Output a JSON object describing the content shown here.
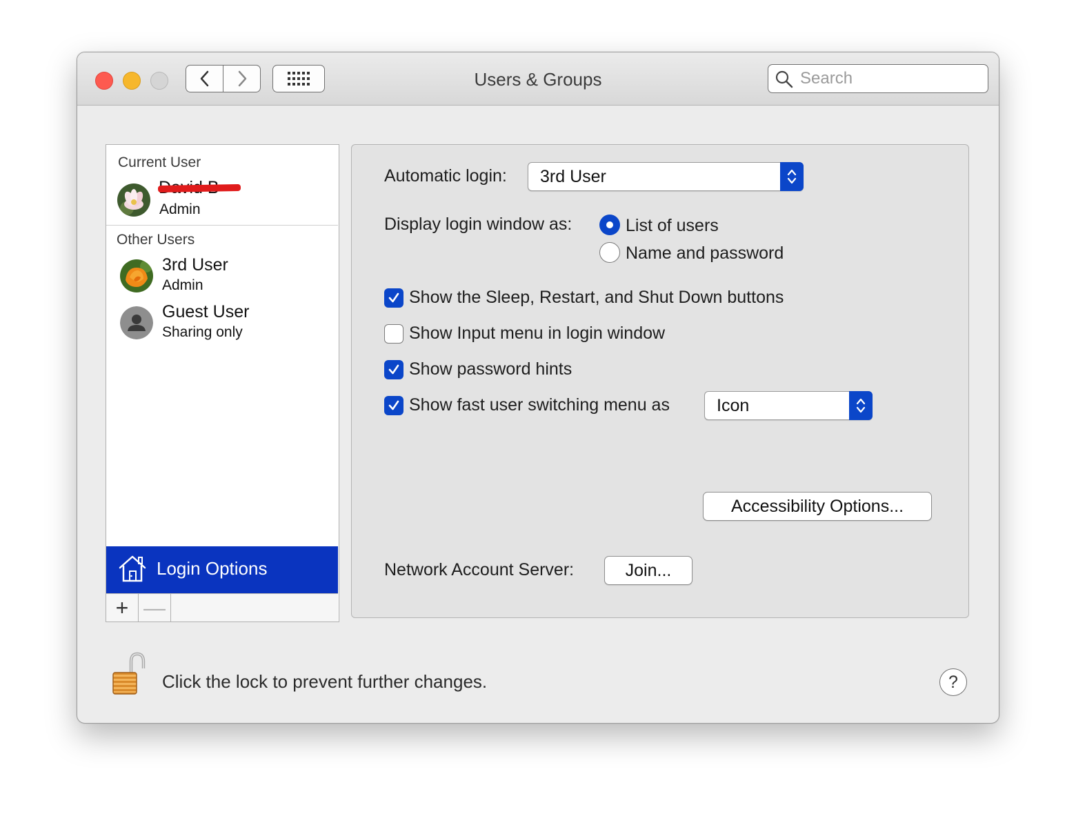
{
  "window": {
    "title": "Users & Groups",
    "search_placeholder": "Search"
  },
  "sidebar": {
    "current_user_heading": "Current User",
    "current_user": {
      "name": "David B",
      "role": "Admin",
      "redacted": true
    },
    "other_users_heading": "Other Users",
    "other_users": [
      {
        "name": "3rd User",
        "role": "Admin",
        "avatar": "flower-orange"
      },
      {
        "name": "Guest User",
        "role": "Sharing only",
        "avatar": "person-silhouette"
      }
    ],
    "login_options_label": "Login Options",
    "add_label": "+",
    "remove_label": "—"
  },
  "login_options": {
    "automatic_login_label": "Automatic login:",
    "automatic_login_value": "3rd User",
    "display_login_label": "Display login window as:",
    "display_options": [
      {
        "label": "List of users",
        "selected": true
      },
      {
        "label": "Name and password",
        "selected": false
      }
    ],
    "checkboxes": [
      {
        "label": "Show the Sleep, Restart, and Shut Down buttons",
        "checked": true
      },
      {
        "label": "Show Input menu in login window",
        "checked": false
      },
      {
        "label": "Show password hints",
        "checked": true
      },
      {
        "label": "Show fast user switching menu as",
        "checked": true
      }
    ],
    "fast_switch_value": "Icon",
    "accessibility_button": "Accessibility Options...",
    "network_label": "Network Account Server:",
    "join_button": "Join..."
  },
  "footer": {
    "lock_text": "Click the lock to prevent further changes.",
    "help_label": "?"
  },
  "colors": {
    "accent": "#0b46c9",
    "selection": "#0a34bf",
    "close": "#fd5a50",
    "minimize": "#f6b72c",
    "redaction": "#e01b1b"
  }
}
